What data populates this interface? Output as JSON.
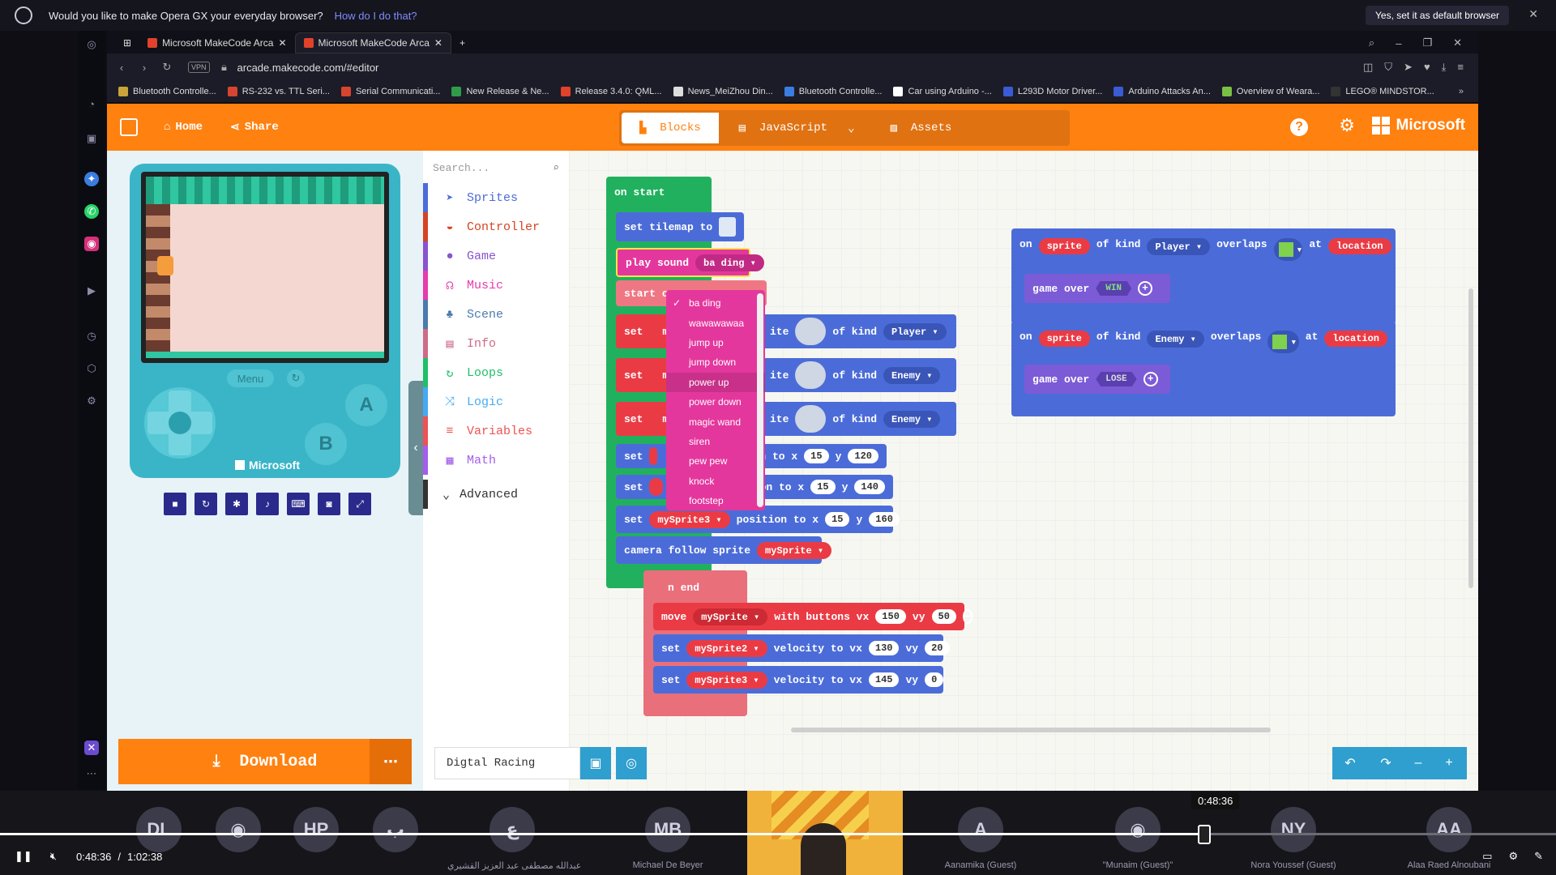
{
  "notification": {
    "question": "Would you like to make Opera GX your everyday browser?",
    "how": "How do I do that?",
    "accept": "Yes, set it as default browser"
  },
  "browser": {
    "tabs": [
      "Microsoft MakeCode Arca",
      "Microsoft MakeCode Arca"
    ],
    "url": "arcade.makecode.com/#editor",
    "vpn": "VPN",
    "bookmarks": [
      {
        "label": "Bluetooth Controlle...",
        "color": "#c8a43a"
      },
      {
        "label": "RS-232 vs. TTL Seri...",
        "color": "#d6452f"
      },
      {
        "label": "Serial Communicati...",
        "color": "#d6452f"
      },
      {
        "label": "New Release & Ne...",
        "color": "#2f9c4a"
      },
      {
        "label": "Release 3.4.0: QML...",
        "color": "#e0422a"
      },
      {
        "label": "News_MeiZhou Din...",
        "color": "#dddddd"
      },
      {
        "label": "Bluetooth Controlle...",
        "color": "#3b7de0"
      },
      {
        "label": "Car using Arduino -...",
        "color": "#ffffff"
      },
      {
        "label": "L293D Motor Driver...",
        "color": "#3a5bd6"
      },
      {
        "label": "Arduino Attacks An...",
        "color": "#3a5bd6"
      },
      {
        "label": "Overview of Weara...",
        "color": "#79c043"
      },
      {
        "label": "LEGO® MINDSTOR...",
        "color": "#333333"
      }
    ]
  },
  "makecode": {
    "home": "Home",
    "share": "Share",
    "tabs": {
      "blocks": "Blocks",
      "javascript": "JavaScript",
      "assets": "Assets"
    },
    "brand": "Microsoft",
    "simulator": {
      "menu": "Menu",
      "brand": "Microsoft",
      "a": "A",
      "b": "B"
    },
    "download": "Download",
    "project_name": "Digtal Racing",
    "search_placeholder": "Search...",
    "toolbox": [
      {
        "label": "Sprites",
        "color": "#4b6cd8",
        "icon": "paper-plane-icon"
      },
      {
        "label": "Controller",
        "color": "#d54322",
        "icon": "gamepad-icon"
      },
      {
        "label": "Game",
        "color": "#8854d0",
        "icon": "circle-icon"
      },
      {
        "label": "Music",
        "color": "#e63cac",
        "icon": "headphones-icon"
      },
      {
        "label": "Scene",
        "color": "#4b7bac",
        "icon": "tree-icon"
      },
      {
        "label": "Info",
        "color": "#cf6a87",
        "icon": "id-card-icon"
      },
      {
        "label": "Loops",
        "color": "#20bf6b",
        "icon": "loop-icon"
      },
      {
        "label": "Logic",
        "color": "#45aaf2",
        "icon": "shuffle-icon"
      },
      {
        "label": "Variables",
        "color": "#ee5253",
        "icon": "list-icon"
      },
      {
        "label": "Math",
        "color": "#a55eea",
        "icon": "calculator-icon"
      }
    ],
    "advanced": "Advanced",
    "blocks": {
      "on_start": "on start",
      "set_tilemap": "set tilemap to",
      "play_sound": "play sound",
      "sound": "ba ding",
      "start_partial": "start c",
      "set": "set",
      "my": "my",
      "ite": "ite",
      "of_kind": "of kind",
      "player": "Player",
      "enemy": "Enemy",
      "n_to_x": "n to x",
      "on_to_x": "on to x",
      "y": "y",
      "row_values": [
        [
          "15",
          "120"
        ],
        [
          "15",
          "140"
        ],
        [
          "15",
          "160"
        ]
      ],
      "mysprite3": "mySprite3",
      "position_to_x": "position to x",
      "camera_follow": "camera follow sprite",
      "mysprite": "mySprite",
      "on_end_partial": "n end",
      "move": "move",
      "with_buttons": "with buttons vx",
      "vy": "vy",
      "move_vx": "150",
      "move_vy": "50",
      "mysprite2": "mySprite2",
      "velocity": "velocity to vx",
      "vel2": [
        "130",
        "20"
      ],
      "vel3": [
        "145",
        "0"
      ],
      "on": "on",
      "sprite": "sprite",
      "overlaps": "overlaps",
      "at": "at",
      "location": "location",
      "game_over": "game over",
      "win": "WIN",
      "lose": "LOSE"
    },
    "sound_options": [
      "ba ding",
      "wawawawaa",
      "jump up",
      "jump down",
      "power up",
      "power down",
      "magic wand",
      "siren",
      "pew pew",
      "knock",
      "footstep"
    ]
  },
  "call": {
    "participants": [
      {
        "initials": "DL",
        "name": ""
      },
      {
        "initials": "",
        "name": ""
      },
      {
        "initials": "HP",
        "name": ""
      },
      {
        "initials": "ب",
        "name": ""
      },
      {
        "initials": "ع",
        "name": "عبدالله مصطفى عبد العزيز القشيري"
      },
      {
        "initials": "MB",
        "name": "Michael De Beyer"
      },
      {
        "initials": "A",
        "name": "Aanamika (Guest)"
      },
      {
        "initials": "",
        "name": "\"Munaim (Guest)\""
      },
      {
        "initials": "NY",
        "name": "Nora Youssef (Guest)"
      },
      {
        "initials": "AA",
        "name": "Alaa Raed Alnoubani"
      }
    ],
    "time_current": "0:48:36",
    "time_sep": "/",
    "time_total": "1:02:38",
    "tooltip": "0:48:36",
    "progress": 0.774
  },
  "colors": {
    "orange": "#ff8110",
    "red": "#ea3b45",
    "blue": "#4b6cd8",
    "pink": "#e4379d",
    "green": "#21b15e"
  }
}
